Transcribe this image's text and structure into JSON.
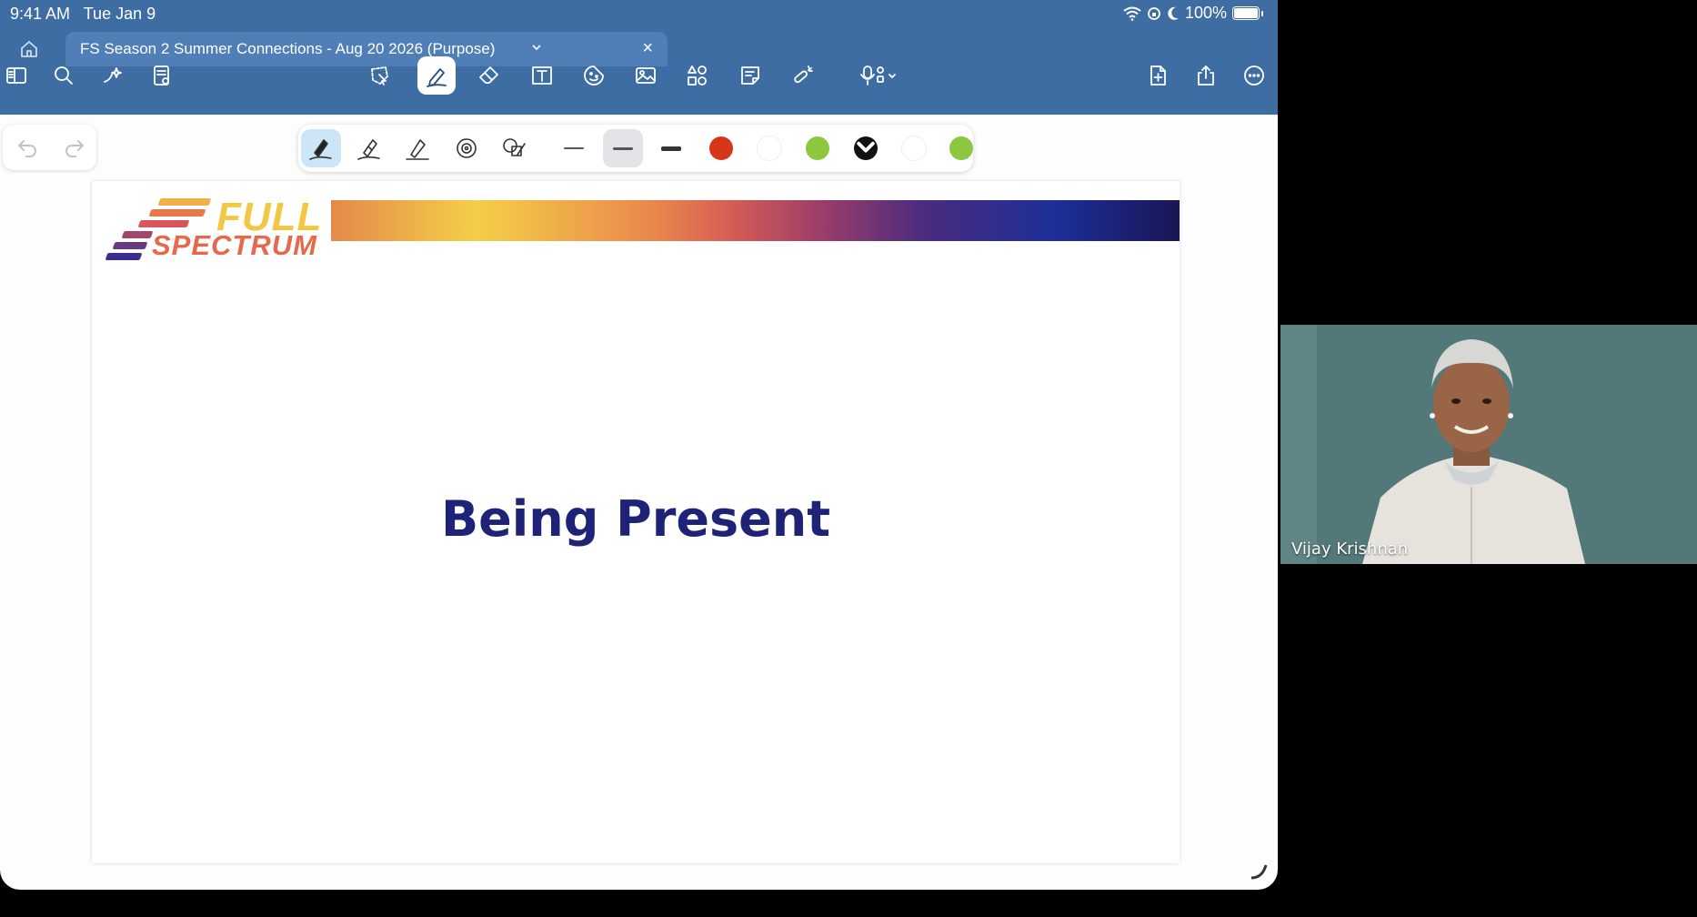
{
  "status_bar": {
    "time": "9:41 AM",
    "date": "Tue Jan 9",
    "battery": "100%",
    "icons": [
      "wifi-icon",
      "rotation-lock-icon",
      "moon-icon",
      "battery-icon"
    ]
  },
  "tabs": {
    "document_title": "FS Season 2 Summer Connections - Aug 20 2026 (Purpose)",
    "chevron": "⌄",
    "close": "×"
  },
  "toolbar": {
    "left": [
      "sidebar-icon",
      "search-icon",
      "sparkle-icon",
      "document-icon"
    ],
    "center": [
      "lasso-select-icon",
      "pen-icon",
      "eraser-icon",
      "text-box-icon",
      "sticker-icon",
      "image-icon",
      "shapes-icon",
      "sticky-note-icon",
      "laser-pointer-icon",
      "microphone-icon"
    ],
    "right": [
      "add-page-icon",
      "share-icon",
      "more-icon"
    ],
    "active_tool": "pen-icon"
  },
  "pen_palette": {
    "tools": [
      "fountain-pen-icon",
      "ball-pen-icon",
      "brush-pen-icon",
      "spiral-icon",
      "shape-pen-icon"
    ],
    "selected_tool": "fountain-pen-icon",
    "stroke_widths": [
      "thin",
      "medium",
      "thick"
    ],
    "selected_width": "medium",
    "colors": [
      "#d8361a",
      "#ffffff",
      "#8dc63f",
      "#111111",
      "#ffffff",
      "#8dc63f"
    ],
    "selected_color": "#111111"
  },
  "slide": {
    "logo_line1": "FULL",
    "logo_line2": "SPECTRUM",
    "title": "Being Present",
    "brand_colors": [
      "#f3c643",
      "#e6694d",
      "#1f2377"
    ]
  },
  "video": {
    "participant_name": "Vijay Krishnan"
  }
}
